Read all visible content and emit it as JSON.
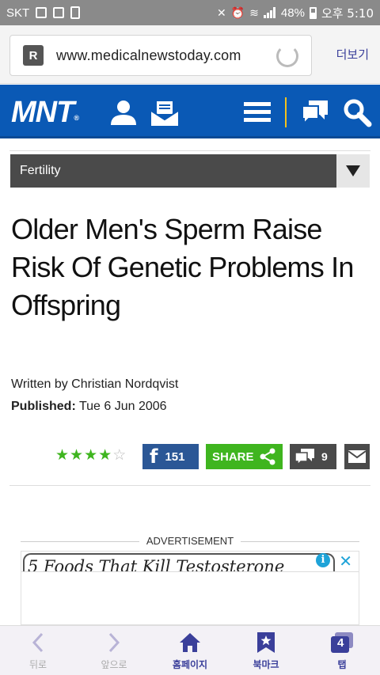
{
  "status_bar": {
    "carrier": "SKT",
    "battery": "48%",
    "time": "오후 5:10"
  },
  "browser": {
    "url": "www.medicalnewstoday.com",
    "more_label": "더보기"
  },
  "site": {
    "logo": "MNT",
    "logo_mark": "®",
    "brand_color": "#0a59b5",
    "accent_color": "#f4c21b"
  },
  "article": {
    "category": "Fertility",
    "title": "Older Men's Sperm Raise Risk Of Genetic Problems In Offspring",
    "byline": "Written by Christian Nordqvist",
    "published_label": "Published:",
    "published_date": "Tue 6 Jun 2006",
    "rating": 4,
    "rating_max": 5
  },
  "share": {
    "facebook_count": "151",
    "share_label": "SHARE",
    "comment_count": "9"
  },
  "ad": {
    "label": "ADVERTISEMENT",
    "headline": "5 Foods That Kill Testosterone",
    "info": "i"
  },
  "bottom_nav": [
    {
      "label": "뒤로"
    },
    {
      "label": "앞으로"
    },
    {
      "label": "홈페이지"
    },
    {
      "label": "북마크"
    },
    {
      "label": "탭",
      "badge": "4"
    }
  ]
}
